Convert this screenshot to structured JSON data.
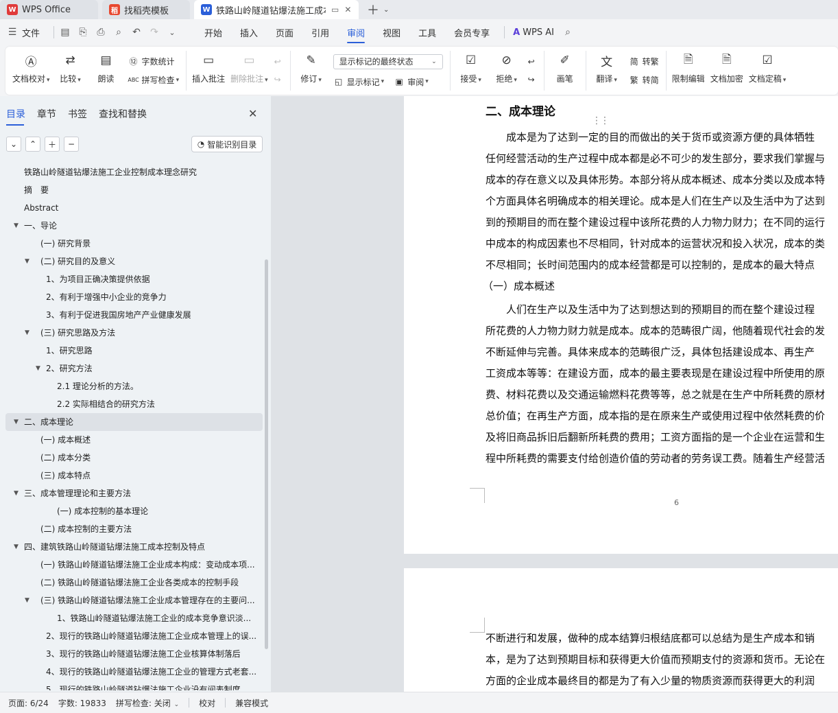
{
  "titlebar": {
    "tabs": [
      {
        "label": "WPS Office",
        "icon": "wps-logo-icon",
        "color": "#e03a3a"
      },
      {
        "label": "找稻壳模板",
        "icon": "docer-icon",
        "color": "#e8472f"
      },
      {
        "label": "铁路山岭隧道钻爆法施工成本",
        "icon": "writer-doc-icon",
        "color": "#2b5fd9"
      }
    ]
  },
  "menubar": {
    "file": "文件",
    "tabs": [
      "开始",
      "插入",
      "页面",
      "引用",
      "审阅",
      "视图",
      "工具",
      "会员专享"
    ],
    "selected_tab": "审阅",
    "ai": "WPS AI"
  },
  "ribbon": {
    "doc_check": "文档校对",
    "compare": "比较",
    "read_aloud": "朗读",
    "word_count": "字数统计",
    "spell_check": "拼写检查",
    "insert_comment": "插入批注",
    "delete_comment": "删除批注",
    "revise": "修订",
    "markup_select": "显示标记的最终状态",
    "show_markup": "显示标记",
    "review": "审阅",
    "accept": "接受",
    "reject": "拒绝",
    "pen": "画笔",
    "translate": "翻译",
    "to_traditional": "转繁",
    "to_simplified": "转简",
    "restrict_edit": "限制编辑",
    "doc_encrypt": "文档加密",
    "doc_finalize": "文档定稿"
  },
  "navpanel": {
    "tabs": [
      "目录",
      "章节",
      "书签",
      "查找和替换"
    ],
    "smart_toc": "智能识别目录",
    "toc": [
      {
        "label": "铁路山岭隧道钻爆法施工企业控制成本理念研究",
        "level": 0,
        "arrow": ""
      },
      {
        "label": "摘　要",
        "level": 0,
        "arrow": ""
      },
      {
        "label": "Abstract",
        "level": 0,
        "arrow": ""
      },
      {
        "label": "一、导论",
        "level": 0,
        "arrow": "▼"
      },
      {
        "label": "(一) 研究背景",
        "level": 1,
        "arrow": ""
      },
      {
        "label": "(二) 研究目的及意义",
        "level": 1,
        "arrow": "▼"
      },
      {
        "label": "1、为项目正确决策提供依据",
        "level": 2,
        "arrow": ""
      },
      {
        "label": "2、有利于增强中小企业的竞争力",
        "level": 2,
        "arrow": ""
      },
      {
        "label": "3、有利于促进我国房地产产业健康发展",
        "level": 2,
        "arrow": ""
      },
      {
        "label": "(三) 研究思路及方法",
        "level": 1,
        "arrow": "▼"
      },
      {
        "label": "1、研究思路",
        "level": 2,
        "arrow": ""
      },
      {
        "label": "2、研究方法",
        "level": 2,
        "arrow": "▼"
      },
      {
        "label": "2.1 理论分析的方法。",
        "level": 3,
        "arrow": ""
      },
      {
        "label": "2.2 实际相结合的研究方法",
        "level": 3,
        "arrow": ""
      },
      {
        "label": "二、成本理论",
        "level": 0,
        "arrow": "▼",
        "selected": true
      },
      {
        "label": "(一) 成本概述",
        "level": 1,
        "arrow": ""
      },
      {
        "label": "(二) 成本分类",
        "level": 1,
        "arrow": ""
      },
      {
        "label": "(三) 成本特点",
        "level": 1,
        "arrow": ""
      },
      {
        "label": "三、成本管理理论和主要方法",
        "level": 0,
        "arrow": "▼"
      },
      {
        "label": "(一) 成本控制的基本理论",
        "level": 3,
        "arrow": ""
      },
      {
        "label": "(二) 成本控制的主要方法",
        "level": 1,
        "arrow": ""
      },
      {
        "label": "四、建筑铁路山岭隧道钻爆法施工成本控制及特点",
        "level": 0,
        "arrow": "▼"
      },
      {
        "label": "(一) 铁路山岭隧道钻爆法施工企业成本构成：变动成本项...",
        "level": 1,
        "arrow": ""
      },
      {
        "label": "(二) 铁路山岭隧道钻爆法施工企业各类成本的控制手段",
        "level": 1,
        "arrow": ""
      },
      {
        "label": "(三) 铁路山岭隧道钻爆法施工企业成本管理存在的主要问...",
        "level": 1,
        "arrow": "▼"
      },
      {
        "label": "1、铁路山岭隧道钻爆法施工企业的成本竞争意识淡...",
        "level": 3,
        "arrow": ""
      },
      {
        "label": "2、现行的铁路山岭隧道钻爆法施工企业成本管理上的误...",
        "level": 2,
        "arrow": ""
      },
      {
        "label": "3、现行的铁路山岭隧道钻爆法施工企业核算体制落后",
        "level": 2,
        "arrow": ""
      },
      {
        "label": "4、现行的铁路山岭隧道钻爆法施工企业的管理方式老套...",
        "level": 2,
        "arrow": ""
      },
      {
        "label": "5、现行的铁路山岭隧道钻爆法施工企业没有间表制度",
        "level": 2,
        "arrow": ""
      }
    ]
  },
  "document": {
    "page1_lines": [
      "二、成本理论",
      "　　成本是为了达到一定的目的而做出的关于货币或资源方便的具体牺牲",
      "任何经营活动的生产过程中成本都是必不可少的发生部分，要求我们掌握与",
      "成本的存在意义以及具体形势。本部分将从成本概述、成本分类以及成本特",
      "个方面具体名明确成本的相关理论。成本是人们在生产以及生活中为了达到",
      "到的预期目的而在整个建设过程中该所花费的人力物力财力；在不同的运行",
      "中成本的构成因素也不尽相同，针对成本的运营状况和投入状况，成本的类",
      "不尽相同；长时间范围内的成本经营都是可以控制的，是成本的最大特点",
      "（一）成本概述",
      "　　人们在生产以及生活中为了达到想达到的预期目的而在整个建设过程",
      "所花费的人力物力财力就是成本。成本的范畴很广阔，他随着现代社会的发",
      "不断延伸与完善。具体来成本的范畴很广泛，具体包括建设成本、再生产",
      "工资成本等等：在建设方面，成本的最主要表现是在建设过程中所使用的原",
      "费、材料花费以及交通运输燃料花费等等，总之就是在生产中所耗费的原材",
      "总价值；在再生产方面，成本指的是在原来生产或使用过程中依然耗费的价",
      "及将旧商品拆旧后翻新所耗费的费用；工资方面指的是一个企业在运营和生",
      "程中所耗费的需要支付给创造价值的劳动者的劳务误工费。随着生产经营活"
    ],
    "page_number": "6",
    "page2_lines": [
      "不断进行和发展，做种的成本结算归根结底都可以总结为是生产成本和销",
      "本，是为了达到预期目标和获得更大价值而预期支付的资源和货币。无论在",
      "方面的企业成本最终目的都是为了有入少量的物质资源而获得更大的利润"
    ]
  },
  "statusbar": {
    "page": "页面: 6/24",
    "words": "字数: 19833",
    "spell": "拼写检查: 关闭",
    "proof": "校对",
    "compat": "兼容模式"
  },
  "colors": {
    "accent": "#2b5fd9",
    "titlebar_bg": "#e8eaee",
    "nav_bg": "#eef2f5",
    "doc_bg": "#dfe2e6"
  }
}
